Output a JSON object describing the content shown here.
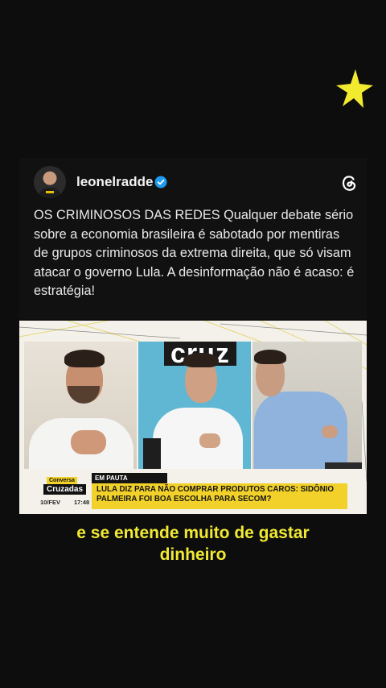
{
  "post": {
    "username": "leonelradde",
    "text": "OS CRIMINOSOS DAS REDES Qualquer debate sério sobre a economia brasileira é sabotado por mentiras de grupos criminosos da extrema direita, que só visam atacar o governo Lula. A desinformação não é acaso: é estratégia!"
  },
  "icons": {
    "decoration": "yellow-star-icon",
    "verified": "verified-badge-icon",
    "app": "threads-icon"
  },
  "video": {
    "studio_sign": "cruz",
    "brand_top": "Conversa",
    "brand_bottom": "Cruzadas",
    "date": "10/FEV",
    "time": "17:48",
    "section_label": "EM PAUTA",
    "headline": "LULA DIZ PARA NÃO COMPRAR PRODUTOS CAROS: SIDÔNIO PALMEIRA FOI BOA ESCOLHA PARA SECOM?"
  },
  "caption": {
    "line1": "e se entende muito de gastar",
    "line2": "dinheiro"
  },
  "colors": {
    "background": "#0d0d0d",
    "caption": "#f1e934",
    "star": "#f2ea2e",
    "verified": "#1d9bf0",
    "lower_third": "#f2d22a"
  }
}
